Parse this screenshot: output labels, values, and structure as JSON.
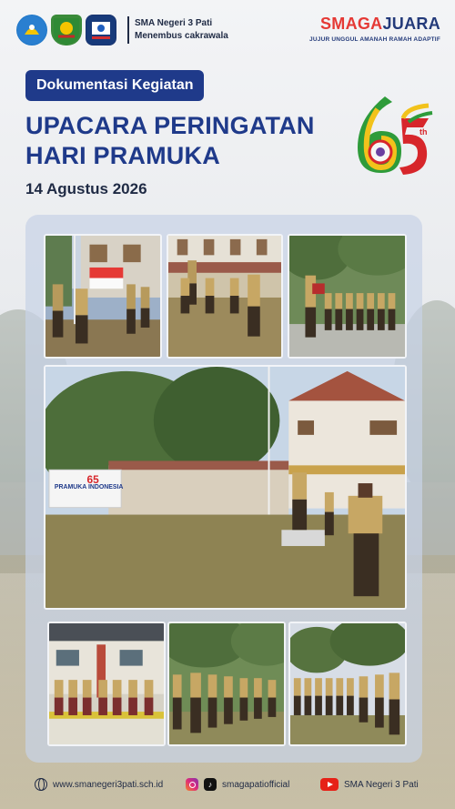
{
  "header": {
    "school_name": "SMA Negeri 3 Pati",
    "school_motto": "Menembus cakrawala",
    "brand_part1": "SMAGA",
    "brand_part2": "JUARA",
    "brand_tagline": "JUJUR UNGGUL AMANAH RAMAH ADAPTIF",
    "logos": [
      "tut-wuri-handayani-logo",
      "pati-regency-logo",
      "school-crest-logo"
    ]
  },
  "content": {
    "badge": "Dokumentasi Kegiatan",
    "title_line1": "UPACARA PERINGATAN",
    "title_line2": "HARI PRAMUKA",
    "date": "14 Agustus 2026"
  },
  "emblem": {
    "number_6": "6",
    "number_5": "5",
    "suffix": "th",
    "colors": {
      "green": "#2e9b3a",
      "yellow": "#f2c21b",
      "red": "#d7262b"
    }
  },
  "photos": {
    "banner_text": "PRAMUKA INDONESIA",
    "banner_number": "65",
    "items": [
      "flag-raising-photo",
      "scouts-in-line-photo",
      "scouts-formation-photo",
      "main-field-ceremony-photo",
      "female-scouts-row-photo",
      "scouts-field-rows-photo",
      "scouts-standing-photo"
    ]
  },
  "footer": {
    "website": "www.smanegeri3pati.sch.id",
    "social_handle": "smagapatiofficial",
    "tiktok_glyph": "♪",
    "youtube_channel": "SMA Negeri 3 Pati"
  },
  "colors": {
    "primary_blue": "#1f3a8a",
    "brand_red": "#e53935",
    "card_bg": "#c8d2e6"
  }
}
